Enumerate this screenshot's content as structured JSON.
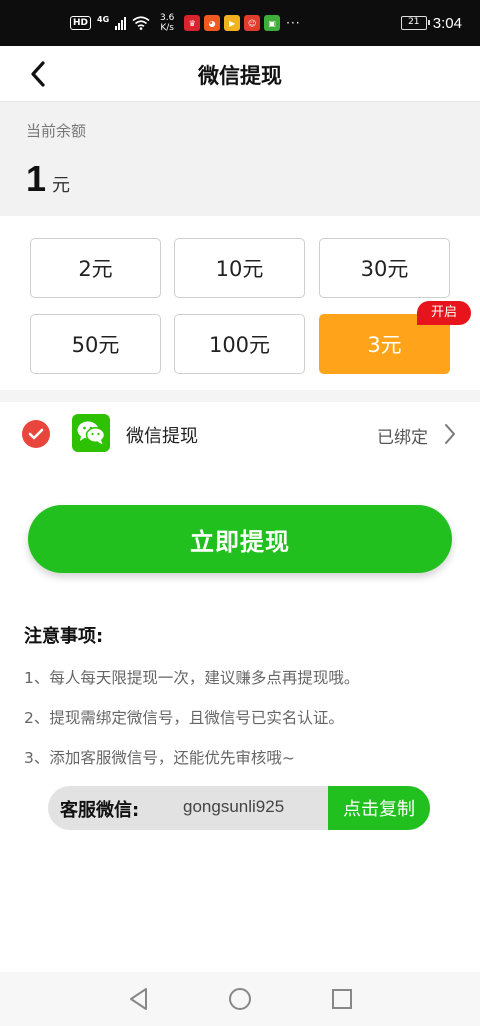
{
  "status_bar": {
    "hd": "HD",
    "network": "4G",
    "speed_value": "3.6",
    "speed_unit": "K/s",
    "more": "···",
    "battery": "21",
    "time": "3:04"
  },
  "navbar": {
    "title": "微信提现"
  },
  "balance": {
    "label": "当前余额",
    "value": "1",
    "unit": "元"
  },
  "options": [
    {
      "label": "2元",
      "selected": false
    },
    {
      "label": "10元",
      "selected": false
    },
    {
      "label": "30元",
      "selected": false
    },
    {
      "label": "50元",
      "selected": false
    },
    {
      "label": "100元",
      "selected": false
    },
    {
      "label": "3元",
      "selected": true,
      "badge": "开启"
    }
  ],
  "payment": {
    "method": "微信提现",
    "status": "已绑定"
  },
  "withdraw_button": "立即提现",
  "notes": {
    "title": "注意事项:",
    "items": [
      "1、每人每天限提现一次，建议赚多点再提现哦。",
      "2、提现需绑定微信号，且微信号已实名认证。",
      "3、添加客服微信号，还能优先审核哦~"
    ]
  },
  "customer_service": {
    "label": "客服微信:",
    "id": "gongsunli925",
    "copy_button": "点击复制"
  },
  "colors": {
    "primary_green": "#21c01f",
    "selected_orange": "#ffa31a",
    "badge_red": "#e8141c",
    "check_red": "#e8453c"
  }
}
